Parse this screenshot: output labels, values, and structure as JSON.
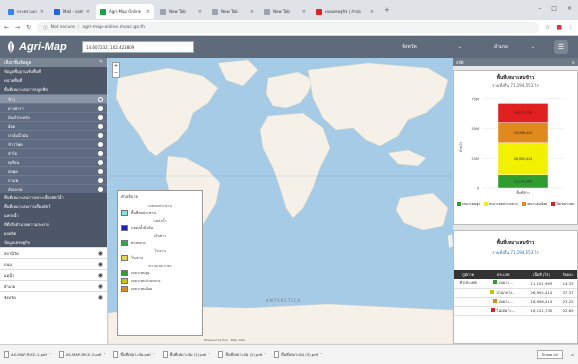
{
  "browser": {
    "tabs": [
      {
        "title": "กระทรวงเกษตรและสหกรณ์",
        "color": "#3b82f6"
      },
      {
        "title": "Mail - sam.somchai.mo...",
        "color": "#2563eb"
      },
      {
        "title": "Agri-Map Online",
        "color": "#16a34a"
      },
      {
        "title": "New Tab",
        "color": "#9ca3af"
      },
      {
        "title": "New Tab",
        "color": "#9ca3af"
      },
      {
        "title": "New Tab",
        "color": "#9ca3af"
      },
      {
        "title": "เขตเศรษฐกิจ | สำนัก",
        "color": "#dc2626"
      }
    ],
    "address": {
      "security": "Not secure",
      "url": "agri-map-online.moac.go.th"
    }
  },
  "app": {
    "logo": "Agri-Map",
    "coordinates": "14.607232, 102.423809",
    "province_label": "จังหวัด",
    "district_label": "อำเภอ"
  },
  "sidebar": {
    "header": "เลือกชั้นข้อมูล",
    "sections": [
      {
        "label": "ข้อมูลพื้นฐานเชิงพื้นที่"
      },
      {
        "label": "หน่วยพื้นที่"
      },
      {
        "label": "พื้นที่เหมาะสมการปลูกพืช"
      }
    ],
    "crops": [
      "ข้าว",
      "ยางพารา",
      "มันสำปะหลัง",
      "อ้อย",
      "ปาล์มน้ำมัน",
      "ข้าวโพด",
      "ลำไย",
      "ทุเรียน",
      "มังคุด",
      "กาแฟ",
      "สับปะรด"
    ],
    "more_sections": [
      {
        "label": "พื้นที่เหมาะสมการเพาะเลี้ยงสัตว์น้ำ"
      },
      {
        "label": "พื้นที่เหมาะสมการเลี้ยงสัตว์"
      },
      {
        "label": "แหล่งน้ำ"
      },
      {
        "label": "ที่ตั้งสิ่งอำนวยความสะดวก"
      },
      {
        "label": "ผลผลิต"
      },
      {
        "label": "ข้อมูลเศรษฐกิจ"
      }
    ],
    "layers": [
      "สถานีวัด",
      "ถนน",
      "แม่น้ำ",
      "อำเภอ",
      "จังหวัด"
    ]
  },
  "map": {
    "ocean_color": "#a6cbe6",
    "land_color": "#f5f1e8",
    "antarctica_label": "ANTARCTICA",
    "attribution": "Powered by Esri · Map data"
  },
  "legend": {
    "title": "คำอธิบาย",
    "groups": [
      {
        "heading": "เขตชลประทาน",
        "items": [
          {
            "label": "พื้นที่ชลประทาน",
            "color": "#7fe3e0"
          }
        ]
      },
      {
        "heading": "แหล่งน้ำ",
        "items": [
          {
            "label": "แหล่งน้ำผิวดิน",
            "color": "#1e1ecc"
          }
        ]
      },
      {
        "heading": "เส้นทาง",
        "items": [
          {
            "label": "ทางหลวง",
            "color": "#2aa84a"
          }
        ]
      },
      {
        "heading": "โรงงาน",
        "items": [
          {
            "label": "โรงงาน",
            "color": "#e8d44a"
          }
        ]
      },
      {
        "heading": "ความเหมาะสม",
        "items": [
          {
            "label": "เหมาะสมสูง",
            "color": "#2f9e2f"
          },
          {
            "label": "เหมาะสมปานกลาง",
            "color": "#c8c800"
          },
          {
            "label": "เหมาะสมน้อย",
            "color": "#e08a1e"
          }
        ]
      }
    ]
  },
  "right_panel": {
    "header": "สถิติ",
    "chart_card": {
      "title": "พื้นที่เหมาะสมข้าว",
      "subtitle": "รวมทั้งสิ้น 71,194,553 ไร่",
      "legend": [
        "เหมาะสมสูง",
        "เหมาะสมปานกลาง",
        "เหมาะสมน้อย",
        "ไม่เหมาะสม"
      ],
      "axis_label": "ล้านไร่",
      "x_label": "พื้นที่ข้าว"
    },
    "table_card": {
      "title": "พื้นที่เหมาะสมข้าว",
      "subtitle": "รวมทั้งสิ้น 71,194,553 ไร่",
      "columns": [
        "ภูมิภาค",
        "ประเภท",
        "เนื้อที่ (ไร่)",
        "ร้อยละ"
      ],
      "rows": [
        {
          "region": "ทั่วประเทศ",
          "type": "เหมาะ...",
          "area": "11,101,995",
          "pct": "14.33",
          "color": "#2f9e2f"
        },
        {
          "region": "",
          "type": "ปานกลาง...",
          "area": "26,992,414",
          "pct": "37.37",
          "color": "#c8c800"
        },
        {
          "region": "",
          "type": "เหมาะ...",
          "area": "16,998,414",
          "pct": "23.25",
          "color": "#e08a1e"
        },
        {
          "region": "",
          "type": "ไม่เหมาะ...",
          "area": "16,151,730",
          "pct": "22.65",
          "color": "#e02020"
        }
      ]
    }
  },
  "chart_data": {
    "type": "bar",
    "stacked": true,
    "categories": [
      "พื้นที่ข้าว"
    ],
    "series": [
      {
        "name": "เหมาะสมสูง",
        "values": [
          11.1
        ],
        "color": "#2f9e2f"
      },
      {
        "name": "เหมาะสมปานกลาง",
        "values": [
          27.0
        ],
        "color": "#f1f100"
      },
      {
        "name": "เหมาะสมน้อย",
        "values": [
          17.0
        ],
        "color": "#e08a1e"
      },
      {
        "name": "ไม่เหมาะสม",
        "values": [
          16.1
        ],
        "color": "#e02020"
      }
    ],
    "bar_labels": [
      "11,101,995",
      "26,992,414",
      "16,998,414",
      "16,151,730"
    ],
    "yticks": [
      "75M",
      "50M",
      "25M",
      "0"
    ],
    "ylabel": "ล้านไร่",
    "ylim": [
      0,
      80
    ]
  },
  "downloads": [
    {
      "name": "AS-MAP-RICE-1.pdf"
    },
    {
      "name": "AS-MAP-RICE-2.pdf"
    },
    {
      "name": "พื้นที่เหมาะสม.pdf"
    },
    {
      "name": "พื้นที่เหมาะสม (1).pdf"
    },
    {
      "name": "พื้นที่เหมาะสม (2).pdf"
    },
    {
      "name": "พื้นที่เหมาะสม (3).pdf"
    }
  ],
  "download_bar": {
    "show_all": "Show all"
  }
}
